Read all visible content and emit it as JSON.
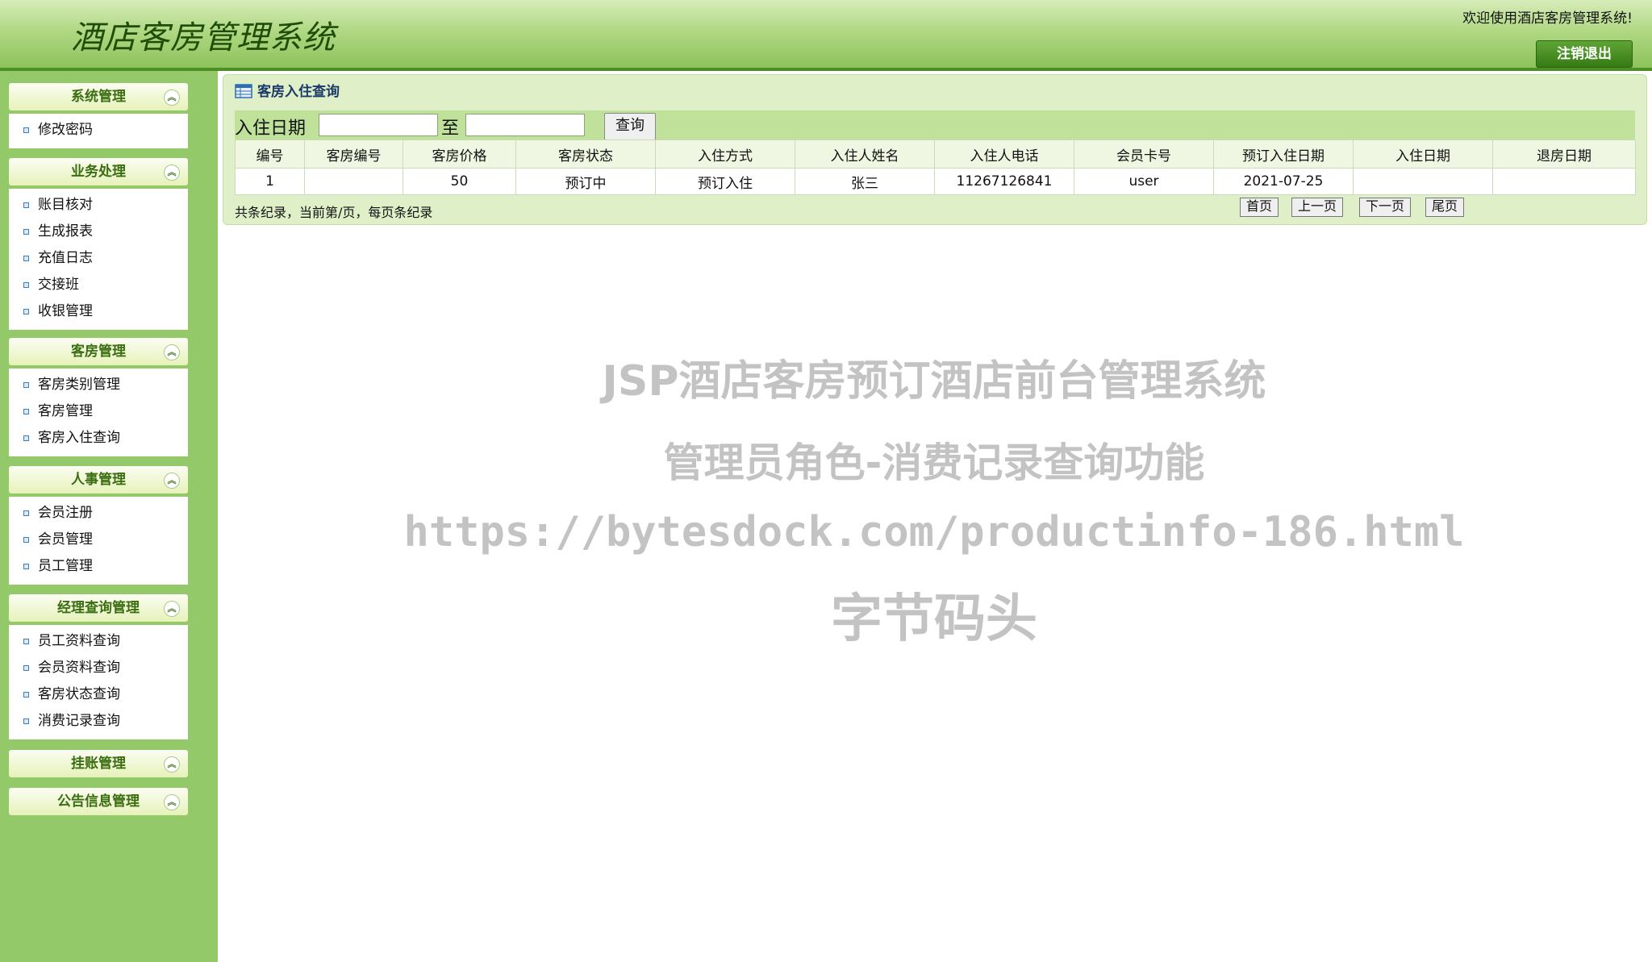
{
  "header": {
    "app_title": "酒店客房管理系统",
    "welcome_text": "欢迎使用酒店客房管理系统!",
    "logout_label": "注销退出"
  },
  "sidebar": {
    "groups": [
      {
        "title": "系统管理",
        "items": [
          "修改密码"
        ]
      },
      {
        "title": "业务处理",
        "items": [
          "账目核对",
          "生成报表",
          "充值日志",
          "交接班",
          "收银管理"
        ]
      },
      {
        "title": "客房管理",
        "items": [
          "客房类别管理",
          "客房管理",
          "客房入住查询"
        ]
      },
      {
        "title": "人事管理",
        "items": [
          "会员注册",
          "会员管理",
          "员工管理"
        ]
      },
      {
        "title": "经理查询管理",
        "items": [
          "员工资料查询",
          "会员资料查询",
          "客房状态查询",
          "消费记录查询"
        ]
      },
      {
        "title": "挂账管理",
        "items": []
      },
      {
        "title": "公告信息管理",
        "items": []
      }
    ]
  },
  "main": {
    "panel_title": "客房入住查询",
    "search": {
      "date_label": "入住日期",
      "to_label": "至",
      "start_value": "",
      "end_value": "",
      "query_label": "查询"
    },
    "table": {
      "headers": [
        "编号",
        "客房编号",
        "客房价格",
        "客房状态",
        "入住方式",
        "入住人姓名",
        "入住人电话",
        "会员卡号",
        "预订入住日期",
        "入住日期",
        "退房日期"
      ],
      "rows": [
        [
          "1",
          "",
          "50",
          "预订中",
          "预订入住",
          "张三",
          "11267126841",
          "user",
          "2021-07-25",
          "",
          ""
        ]
      ]
    },
    "pager": {
      "summary": "共条纪录，当前第/页，每页条纪录",
      "first": "首页",
      "prev": "上一页",
      "next": "下一页",
      "last": "尾页"
    }
  },
  "watermark": {
    "line1": "JSP酒店客房预订酒店前台管理系统",
    "line2": "管理员角色-消费记录查询功能",
    "line3": "https://bytesdock.com/productinfo-186.html",
    "line4": "字节码头"
  }
}
